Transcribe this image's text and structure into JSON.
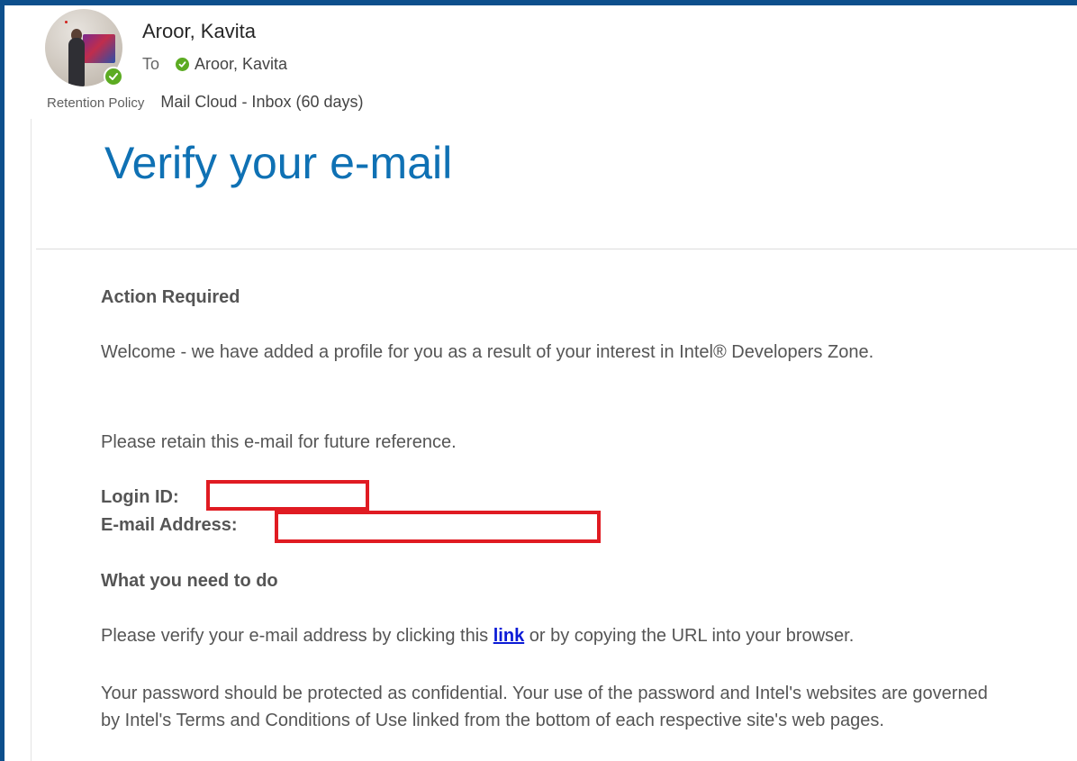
{
  "sender": {
    "name": "Aroor, Kavita",
    "to_label": "To",
    "recipient": "Aroor, Kavita"
  },
  "retention": {
    "label": "Retention Policy",
    "value": "Mail Cloud - Inbox (60 days)"
  },
  "email": {
    "title": "Verify your e-mail",
    "action_heading": "Action Required",
    "welcome": "Welcome - we have added a profile for you as a result of your interest in Intel® Developers Zone.",
    "retain": "Please retain this e-mail for future reference.",
    "login_label": "Login ID:",
    "email_label": "E-mail Address:",
    "todo_heading": "What you need to do",
    "verify_before": "Please verify your e-mail address by clicking this ",
    "verify_link": "link",
    "verify_after": " or by copying the URL into your browser.",
    "password_note": "Your password should be protected as confidential. Your use of the password and Intel's websites are governed by Intel's Terms and Conditions of Use linked from the bottom of each respective site's web pages."
  },
  "colors": {
    "frame": "#0d4f8c",
    "title": "#0f71b4",
    "presence": "#5cab22",
    "redaction": "#e01b22",
    "link": "#0a1ad6"
  },
  "icons": [
    "avatar",
    "presence-available-icon",
    "recipient-available-icon"
  ]
}
